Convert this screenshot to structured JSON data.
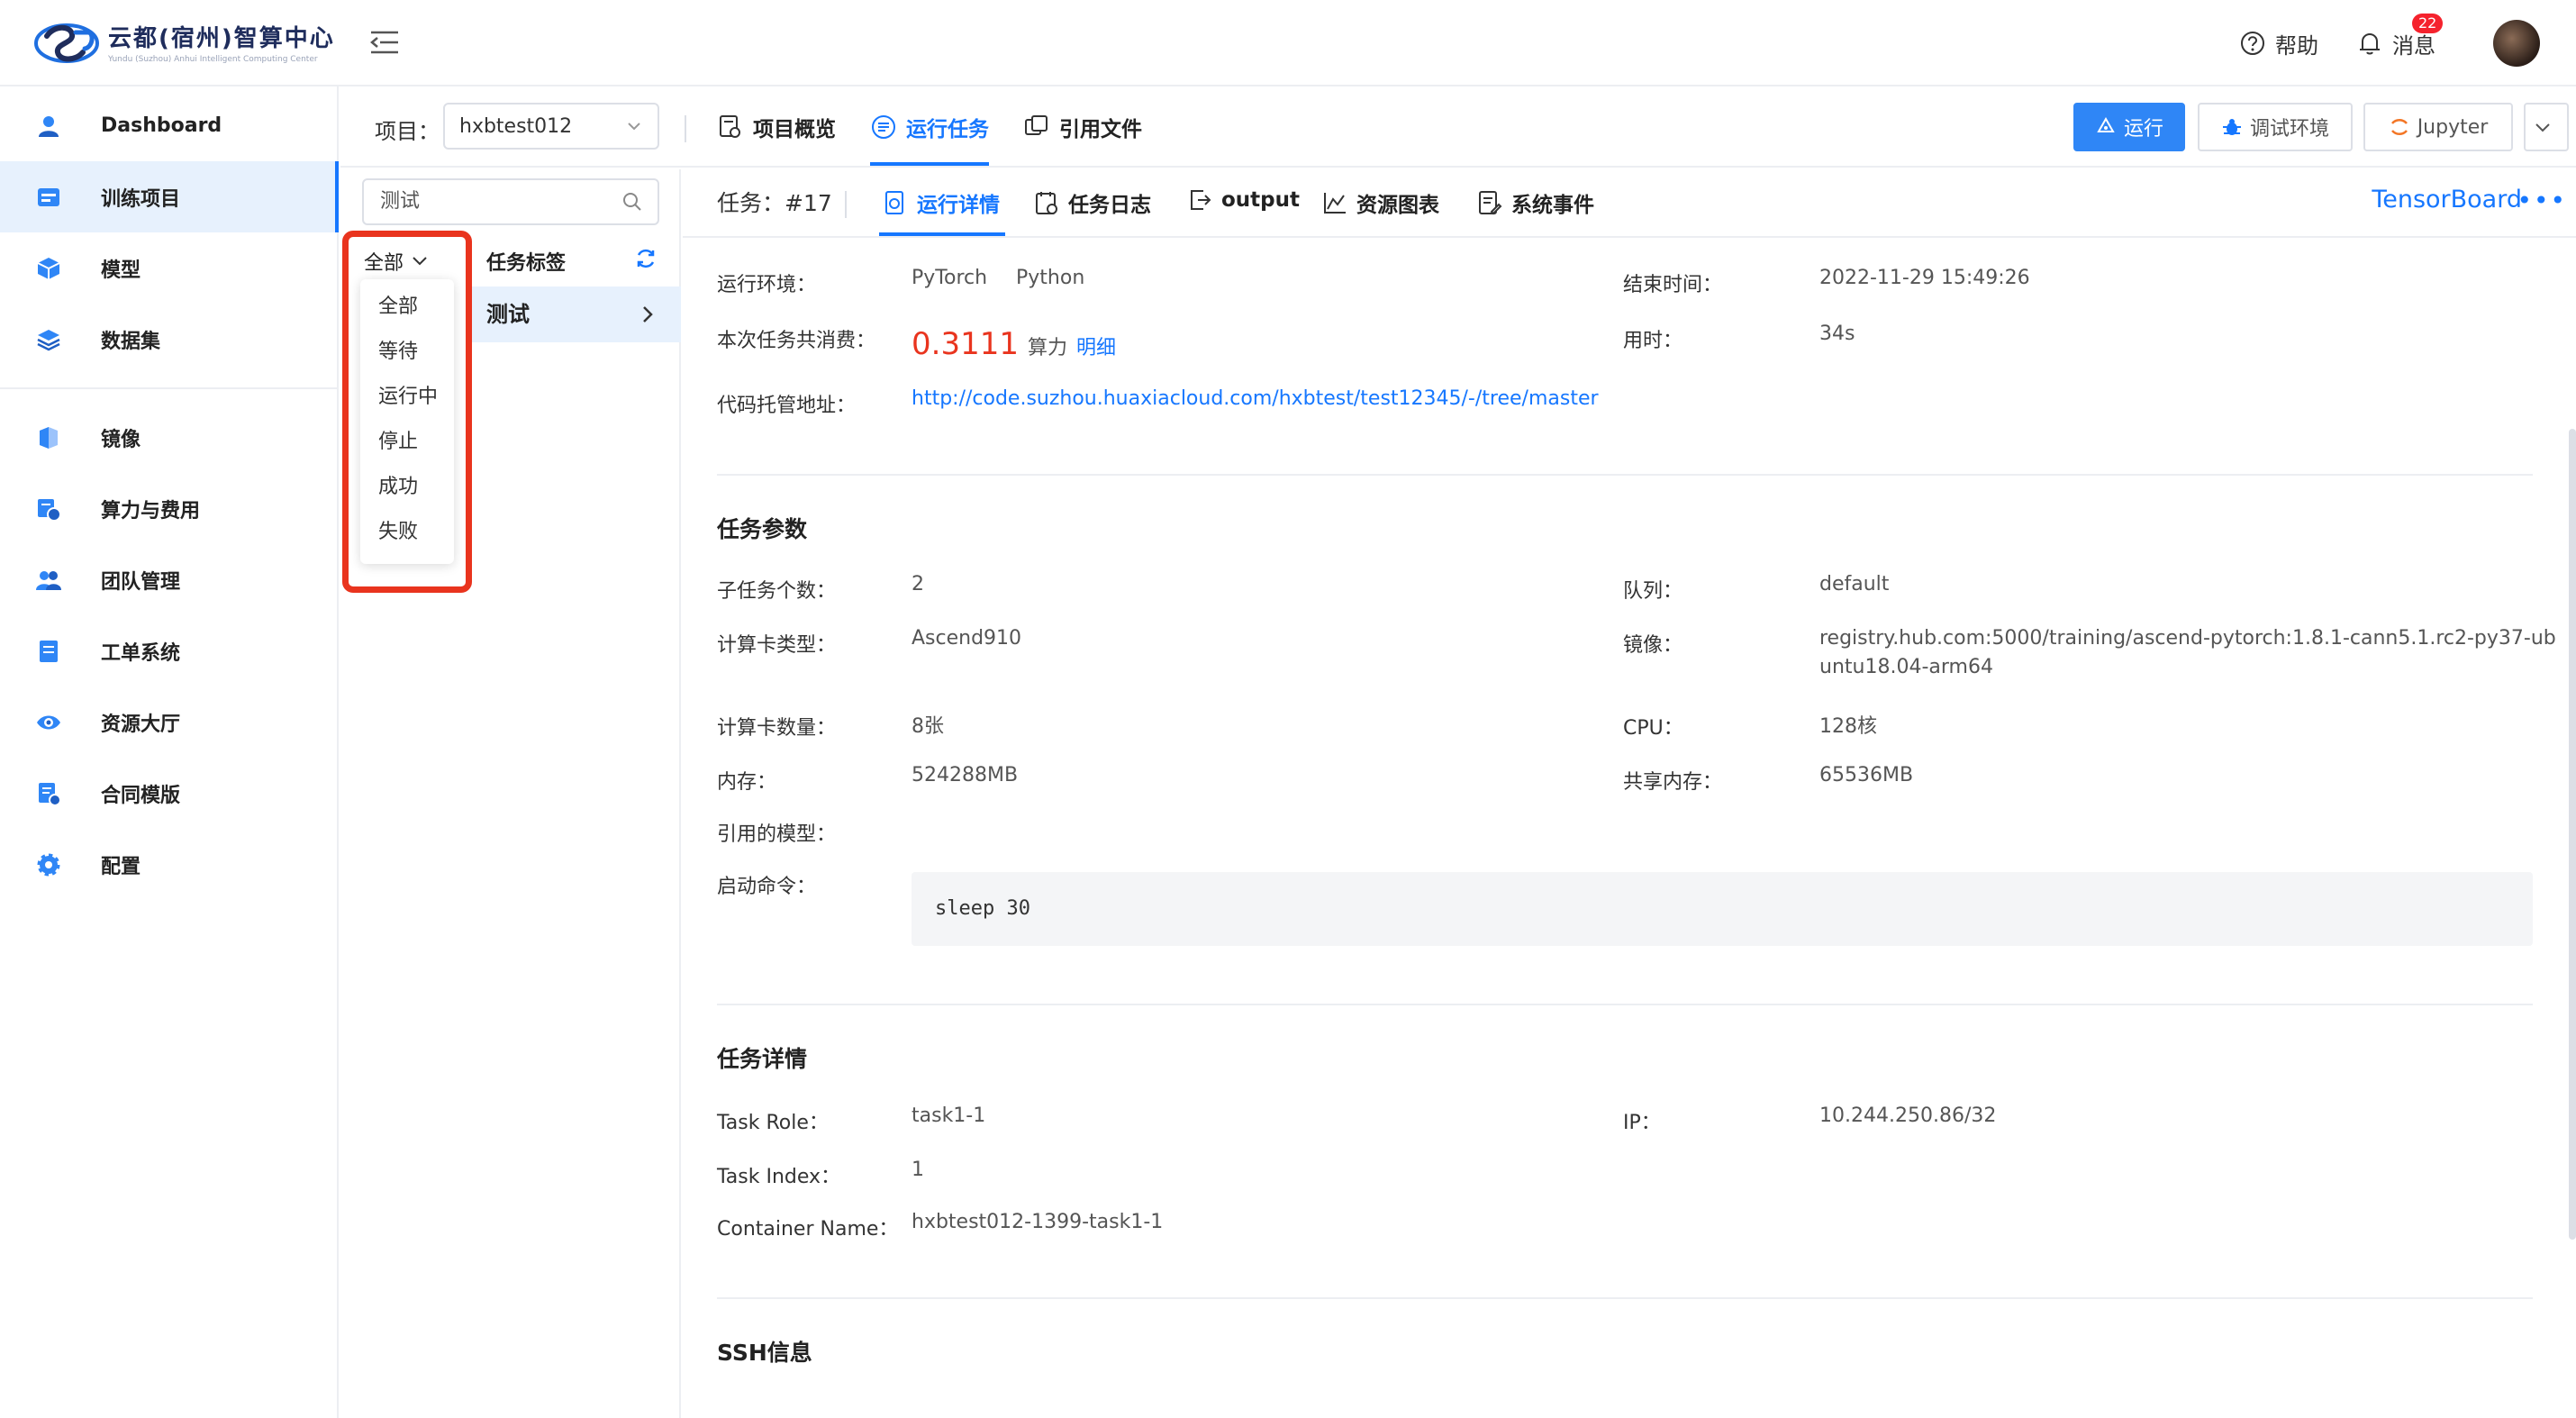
{
  "brand": {
    "title": "云都(宿州)智算中心",
    "subtitle": "Yundu (Suzhou) Anhui Intelligent Computing Center"
  },
  "header": {
    "help_label": "帮助",
    "messages_label": "消息",
    "messages_badge": "22"
  },
  "sidebar": {
    "items": [
      {
        "label": "Dashboard",
        "icon": "user-icon"
      },
      {
        "label": "训练项目",
        "icon": "project-icon",
        "active": true
      },
      {
        "label": "模型",
        "icon": "cube-icon"
      },
      {
        "label": "数据集",
        "icon": "layers-icon"
      },
      {
        "label": "镜像",
        "icon": "image-icon"
      },
      {
        "label": "算力与费用",
        "icon": "billing-icon"
      },
      {
        "label": "团队管理",
        "icon": "team-icon"
      },
      {
        "label": "工单系统",
        "icon": "ticket-icon"
      },
      {
        "label": "资源大厅",
        "icon": "eye-icon"
      },
      {
        "label": "合同模版",
        "icon": "contract-icon"
      },
      {
        "label": "配置",
        "icon": "gear-icon"
      }
    ]
  },
  "project_bar": {
    "label": "项目：",
    "selected": "hxbtest012",
    "tabs": [
      "项目概览",
      "运行任务",
      "引用文件"
    ],
    "active_tab": "运行任务",
    "run_label": "运行",
    "debug_label": "调试环境",
    "jupyter_label": "Jupyter"
  },
  "filter": {
    "search_value": "测试",
    "status_selected": "全部",
    "status_options": [
      "全部",
      "等待",
      "运行中",
      "停止",
      "成功",
      "失败"
    ],
    "tag_header": "任务标签",
    "tags": [
      "测试"
    ]
  },
  "task_header": {
    "title": "任务：#17",
    "tabs": [
      "运行详情",
      "任务日志",
      "output",
      "资源图表",
      "系统事件"
    ],
    "active_tab": "运行详情",
    "tensorboard_label": "TensorBoard",
    "more_label": "•••"
  },
  "overview": {
    "env_label": "运行环境：",
    "env_values": [
      "PyTorch",
      "Python"
    ],
    "end_time_label": "结束时间：",
    "end_time": "2022-11-29 15:49:26",
    "cost_label": "本次任务共消费：",
    "cost_value": "0.3111",
    "cost_unit": "算力",
    "cost_detail": "明细",
    "duration_label": "用时：",
    "duration": "34s",
    "repo_label": "代码托管地址：",
    "repo_url": "http://code.suzhou.huaxiacloud.com/hxbtest/test12345/-/tree/master"
  },
  "params": {
    "title": "任务参数",
    "subtask_label": "子任务个数：",
    "subtask_value": "2",
    "queue_label": "队列：",
    "queue_value": "default",
    "card_type_label": "计算卡类型：",
    "card_type_value": "Ascend910",
    "image_label": "镜像：",
    "image_value_1": "registry.hub.com:5000/training/ascend-pytorch:1.8.1-cann5.1.rc2-py37-ub",
    "image_value_2": "untu18.04-arm64",
    "card_count_label": "计算卡数量：",
    "card_count_value": "8张",
    "cpu_label": "CPU：",
    "cpu_value": "128核",
    "memory_label": "内存：",
    "memory_value": "524288MB",
    "shm_label": "共享内存：",
    "shm_value": "65536MB",
    "model_label": "引用的模型：",
    "command_label": "启动命令：",
    "command_value": "sleep 30"
  },
  "details": {
    "title": "任务详情",
    "role_label": "Task Role：",
    "role_value": "task1-1",
    "ip_label": "IP：",
    "ip_value": "10.244.250.86/32",
    "index_label": "Task Index：",
    "index_value": "1",
    "container_label": "Container Name：",
    "container_value": "hxbtest012-1399-task1-1"
  },
  "ssh": {
    "title": "SSH信息"
  },
  "colors": {
    "primary": "#1677ff",
    "danger": "#e9341e",
    "active_bg": "#e7f1fd"
  }
}
